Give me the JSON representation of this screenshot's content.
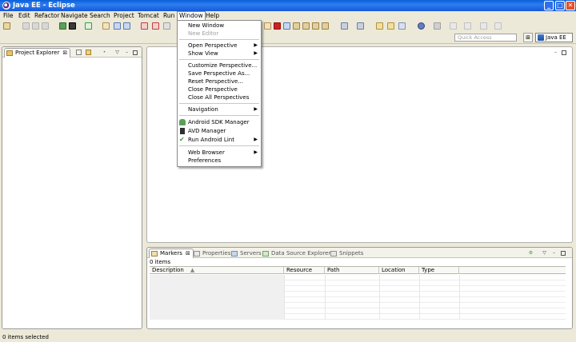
{
  "window": {
    "title": "Java EE - Eclipse",
    "min_label": "_",
    "max_label": "□",
    "close_label": "✕"
  },
  "menubar": [
    "File",
    "Edit",
    "Refactor",
    "Navigate",
    "Search",
    "Project",
    "Tomcat",
    "Run",
    "Window",
    "Help"
  ],
  "toolbar": {
    "quick_access_placeholder": "Quick Access",
    "open_perspective_glyph": "⊞",
    "perspective_label": "Java EE"
  },
  "project_explorer": {
    "tab_label": "Project Explorer",
    "close_glyph": "⊠"
  },
  "bottom_panel": {
    "tabs": [
      "Markers",
      "Properties",
      "Servers",
      "Data Source Explorer",
      "Snippets"
    ],
    "close_glyph": "⊠",
    "items_count": "0 items",
    "columns": [
      "Description",
      "Resource",
      "Path",
      "Location",
      "Type"
    ]
  },
  "status": {
    "text": "0 items selected"
  },
  "window_menu": {
    "items": [
      {
        "label": "New Window",
        "disabled": false,
        "submenu": false
      },
      {
        "label": "New Editor",
        "disabled": true,
        "submenu": false
      },
      {
        "label": "Open Perspective",
        "disabled": false,
        "submenu": true
      },
      {
        "label": "Show View",
        "disabled": false,
        "submenu": true
      },
      {
        "label": "Customize Perspective...",
        "disabled": false,
        "submenu": false
      },
      {
        "label": "Save Perspective As...",
        "disabled": false,
        "submenu": false
      },
      {
        "label": "Reset Perspective...",
        "disabled": false,
        "submenu": false
      },
      {
        "label": "Close Perspective",
        "disabled": false,
        "submenu": false
      },
      {
        "label": "Close All Perspectives",
        "disabled": false,
        "submenu": false
      },
      {
        "label": "Navigation",
        "disabled": false,
        "submenu": true
      },
      {
        "label": "Android SDK Manager",
        "disabled": false,
        "submenu": false,
        "icon": "android-icon"
      },
      {
        "label": "AVD Manager",
        "disabled": false,
        "submenu": false,
        "icon": "phone-icon"
      },
      {
        "label": "Run Android Lint",
        "disabled": false,
        "submenu": true,
        "icon": "check-icon"
      },
      {
        "label": "Web Browser",
        "disabled": false,
        "submenu": true
      },
      {
        "label": "Preferences",
        "disabled": false,
        "submenu": false
      }
    ],
    "arrow_glyph": "▶"
  },
  "colors": {
    "titlebar": "#1659d8",
    "accent_green": "#3c9a3c",
    "error_red": "#d02020"
  }
}
